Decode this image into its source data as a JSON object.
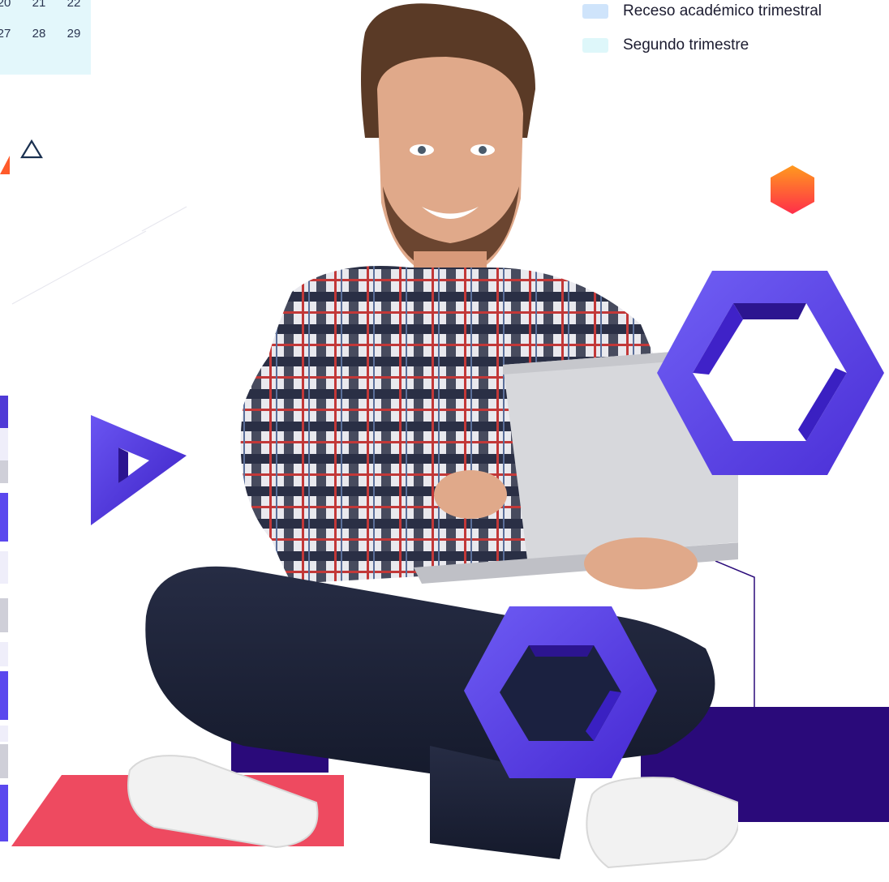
{
  "calendar": {
    "rows": [
      [
        "20",
        "21",
        "22"
      ],
      [
        "27",
        "28",
        "29"
      ]
    ]
  },
  "legend": [
    {
      "label": "Receso académico trimestral",
      "color": "#cfe4fb"
    },
    {
      "label": "Segundo trimestre",
      "color": "#def7fa"
    }
  ],
  "colors": {
    "purple": "#5b3fe6",
    "deep_purple": "#2a0a7a",
    "coral": "#ee4a60",
    "orange": "#ff6a2a"
  },
  "icons": [
    "outline-triangle-icon",
    "orange-hexagon-icon",
    "purple-triangle-icon",
    "purple-hexagon-icon"
  ]
}
